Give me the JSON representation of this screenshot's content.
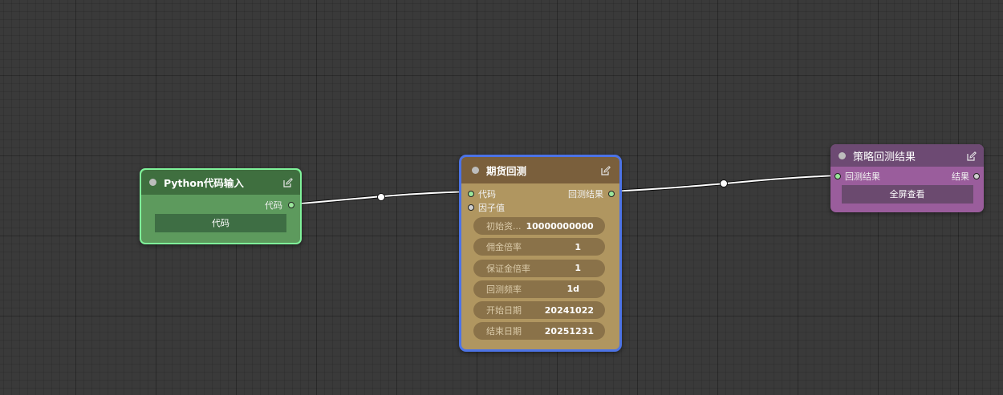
{
  "nodes": {
    "python_input": {
      "title": "Python代码输入",
      "output_label": "代码",
      "button_label": "代码",
      "colors": {
        "title": "#3f7a3f",
        "body": "#5d9a5d",
        "border": "#7ff29a"
      }
    },
    "futures_backtest": {
      "title": "期货回测",
      "inputs": [
        "代码",
        "因子值"
      ],
      "output_label": "回测结果",
      "params": [
        {
          "label": "初始资...",
          "value": "10000000000"
        },
        {
          "label": "佣金倍率",
          "value": "1"
        },
        {
          "label": "保证金倍率",
          "value": "1"
        },
        {
          "label": "回测频率",
          "value": "1d"
        },
        {
          "label": "开始日期",
          "value": "20241022"
        },
        {
          "label": "结束日期",
          "value": "20251231"
        }
      ],
      "colors": {
        "title": "#7a5f3c",
        "body": "#b09660",
        "border": "#4c73e6"
      }
    },
    "strategy_result": {
      "title": "策略回测结果",
      "input_label": "回测结果",
      "output_label": "结果",
      "button_label": "全屏查看",
      "colors": {
        "title": "#6d4a73",
        "body": "#9a5d9c"
      }
    }
  },
  "icons": {
    "edit": "edit-icon",
    "slot": "slot-dot"
  }
}
